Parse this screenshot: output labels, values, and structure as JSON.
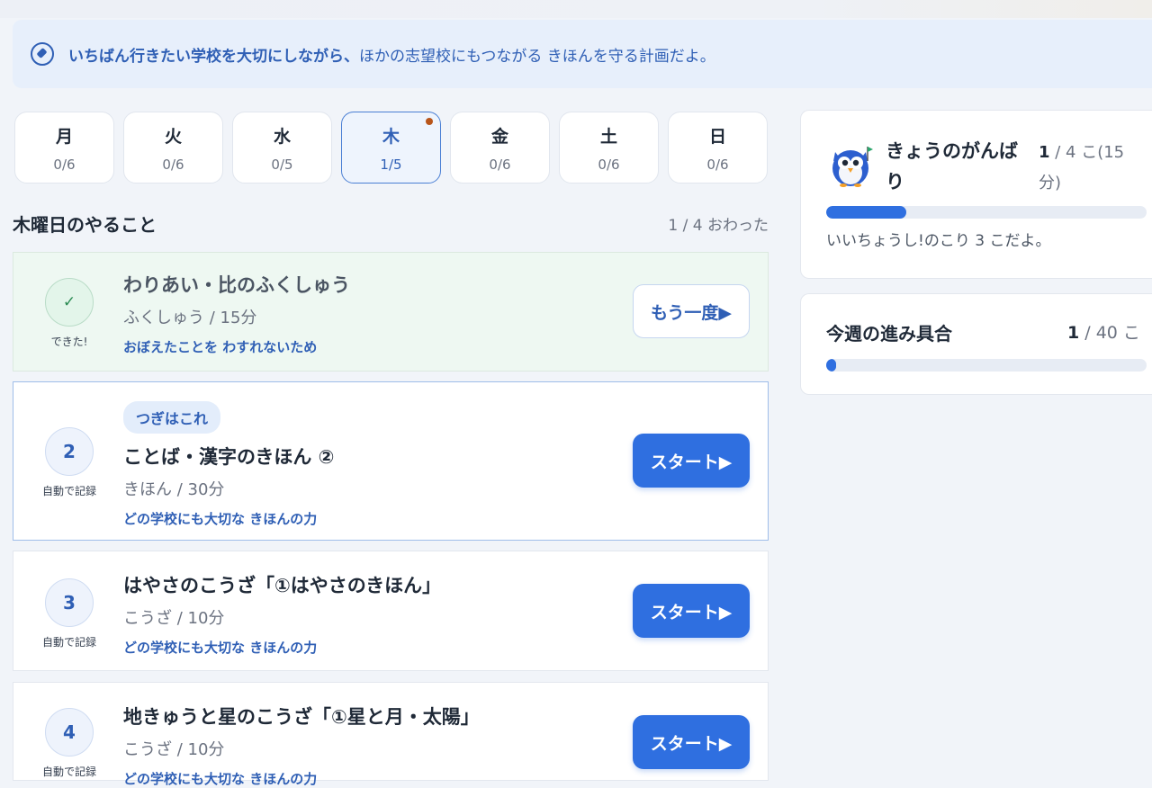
{
  "banner": {
    "strong": "いちばん行きたい学校を大切にしながら、",
    "rest": "ほかの志望校にもつながる きほんを守る計画だよ。"
  },
  "days": [
    {
      "name": "月",
      "count": "0/6",
      "active": false
    },
    {
      "name": "火",
      "count": "0/6",
      "active": false
    },
    {
      "name": "水",
      "count": "0/5",
      "active": false
    },
    {
      "name": "木",
      "count": "1/5",
      "active": true
    },
    {
      "name": "金",
      "count": "0/6",
      "active": false
    },
    {
      "name": "土",
      "count": "0/6",
      "active": false
    },
    {
      "name": "日",
      "count": "0/6",
      "active": false
    }
  ],
  "section": {
    "title": "木曜日のやること",
    "progress": "1 / 4 おわった"
  },
  "tasks": [
    {
      "badge": "✓",
      "caption": "できた!",
      "title": "わりあい・比のふくしゅう",
      "meta": "ふくしゅう / 15分",
      "purpose": "おぼえたことを わすれないため",
      "button": "もう一度▶"
    },
    {
      "badge": "2",
      "caption": "自動で記録",
      "pill": "つぎはこれ",
      "title": "ことば・漢字のきほん ②",
      "meta": "きほん / 30分",
      "purpose": "どの学校にも大切な きほんの力",
      "button": "スタート▶"
    },
    {
      "badge": "3",
      "caption": "自動で記録",
      "title": "はやさのこうざ「①はやさのきほん」",
      "meta": "こうざ / 10分",
      "purpose": "どの学校にも大切な きほんの力",
      "button": "スタート▶"
    },
    {
      "badge": "4",
      "caption": "自動で記録",
      "title": "地きゅうと星のこうざ「①星と月・太陽」",
      "meta": "こうざ / 10分",
      "purpose": "どの学校にも大切な きほんの力",
      "button": "スタート▶"
    }
  ],
  "today": {
    "title": "きょうのがんばり",
    "done": "1",
    "rest": " / 4 こ(15分)",
    "progress": 0.25,
    "message": "いいちょうし!のこり 3 こだよ。"
  },
  "week": {
    "title": "今週の進み具合",
    "done": "1",
    "rest": " / 40 こ",
    "progress": 0.025
  },
  "colors": {
    "accent": "#2f6fe0",
    "accent_text": "#2f5fb5",
    "done_bg": "#eef8f2",
    "banner_bg": "#e7effb"
  }
}
